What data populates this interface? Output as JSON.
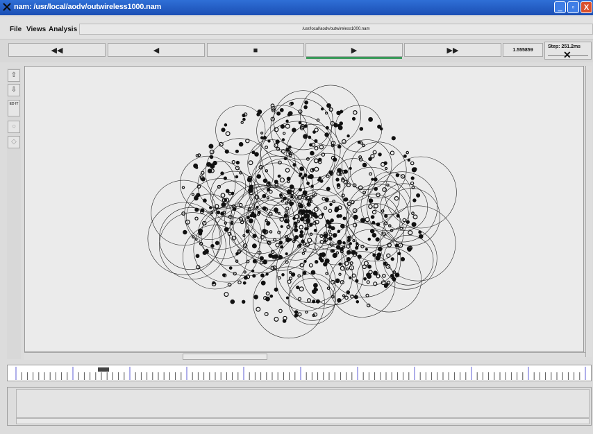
{
  "window": {
    "title": "nam: /usr/local/aodv/outwireless1000.nam",
    "min_glyph": "_",
    "max_glyph": "▫",
    "close_glyph": "X"
  },
  "menu": {
    "file_label": "File",
    "views_label": "Views",
    "analysis_label": "Analysis",
    "path_label": "/usr/local/aodv/outwireless1000.nam"
  },
  "controls": {
    "rewind_glyph": "◀◀",
    "back_glyph": "◀",
    "stop_glyph": "■",
    "play_glyph": "▶",
    "fastforward_glyph": "▶▶",
    "time_value": "1.555859",
    "step_label": "Step: 251.2ms",
    "step_thumb_glyph": "✕"
  },
  "tools": {
    "zoom_in_glyph": "⇧",
    "zoom_out_glyph": "⇩",
    "edit_label": "ED IT"
  },
  "icons": [
    "nam-app-icon",
    "minimize-icon",
    "maximize-icon",
    "close-icon",
    "rewind-icon",
    "back-icon",
    "stop-icon",
    "play-icon",
    "fast-forward-icon",
    "zoom-in-icon",
    "zoom-out-icon"
  ],
  "colors": {
    "titlebar": "#2f6fd6",
    "play_active": "#3b9a5b",
    "timeline_major_tick": "#5c5cd6"
  }
}
